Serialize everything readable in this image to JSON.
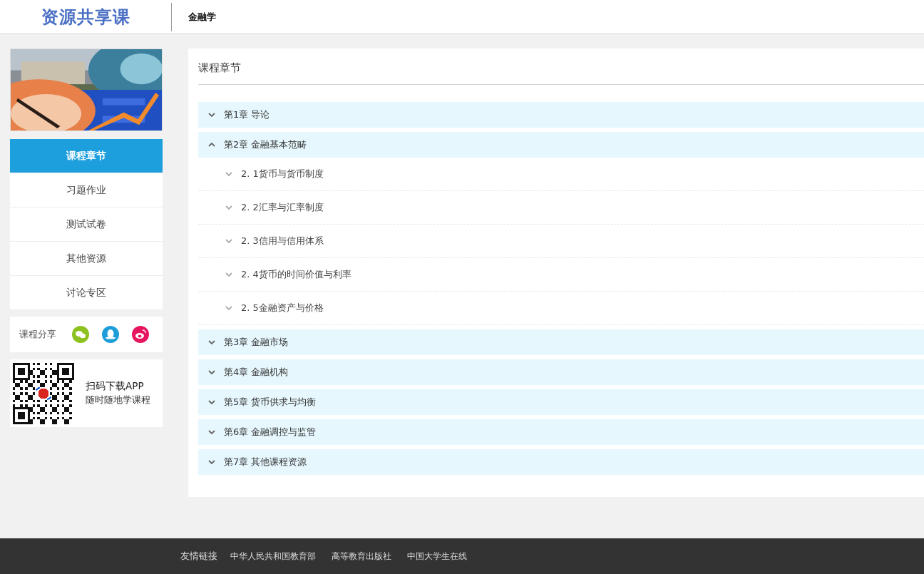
{
  "header": {
    "logo": "资源共享课",
    "course": "金融学"
  },
  "sidebar": {
    "items": [
      {
        "label": "课程章节",
        "selected": true
      },
      {
        "label": "习题作业",
        "selected": false
      },
      {
        "label": "测试试卷",
        "selected": false
      },
      {
        "label": "其他资源",
        "selected": false
      },
      {
        "label": "讨论专区",
        "selected": false
      }
    ]
  },
  "share": {
    "label": "课程分享"
  },
  "app_download": {
    "line_1": "扫码下载APP",
    "line_2": "随时随地学课程"
  },
  "main": {
    "title": "课程章节",
    "chapters": [
      {
        "title": "第1章 导论",
        "expanded": false
      },
      {
        "title": "第2章 金融基本范畴",
        "expanded": true,
        "children": [
          {
            "title": "2. 1货币与货币制度",
            "expanded": false
          },
          {
            "title": "2. 2汇率与汇率制度",
            "expanded": false
          },
          {
            "title": "2. 3信用与信用体系",
            "expanded": false
          },
          {
            "title": "2. 4货币的时间价值与利率",
            "expanded": false
          },
          {
            "title": "2. 5金融资产与价格",
            "expanded": false
          }
        ]
      },
      {
        "title": "第3章 金融市场",
        "expanded": false
      },
      {
        "title": "第4章 金融机构",
        "expanded": false
      },
      {
        "title": "第5章 货币供求与均衡",
        "expanded": false
      },
      {
        "title": "第6章 金融调控与监管",
        "expanded": false
      },
      {
        "title": "第7章 其他课程资源",
        "expanded": false
      }
    ]
  },
  "footer": {
    "label": "友情链接",
    "links": [
      "中华人民共和国教育部",
      "高等教育出版社",
      "中国大学生在线"
    ]
  }
}
